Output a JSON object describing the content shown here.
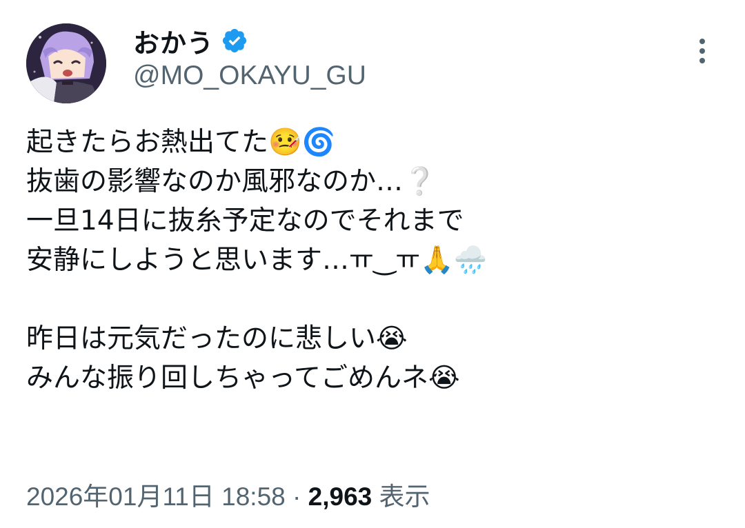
{
  "author": {
    "display_name": "おかう",
    "handle": "@MO_OKAYU_GU",
    "verified": true,
    "avatar_icon": "avatar-image"
  },
  "tweet": {
    "lines": [
      "起きたらお熱出てた🤒🌀",
      "抜歯の影響なのか風邪なのか…❔",
      "一旦14日に抜糸予定なのでそれまで",
      "安静にしようと思います…ㅠ‿ㅠ🙏🌧️",
      "",
      "昨日は元気だったのに悲しい😭",
      "みんな振り回しちゃってごめんネ😭"
    ]
  },
  "meta": {
    "timestamp": "2026年01月11日 18:58",
    "separator": "·",
    "views_count": "2,963",
    "views_label": "表示"
  },
  "colors": {
    "text_primary": "#0f1419",
    "text_secondary": "#536471",
    "verified_blue": "#1d9bf0"
  }
}
